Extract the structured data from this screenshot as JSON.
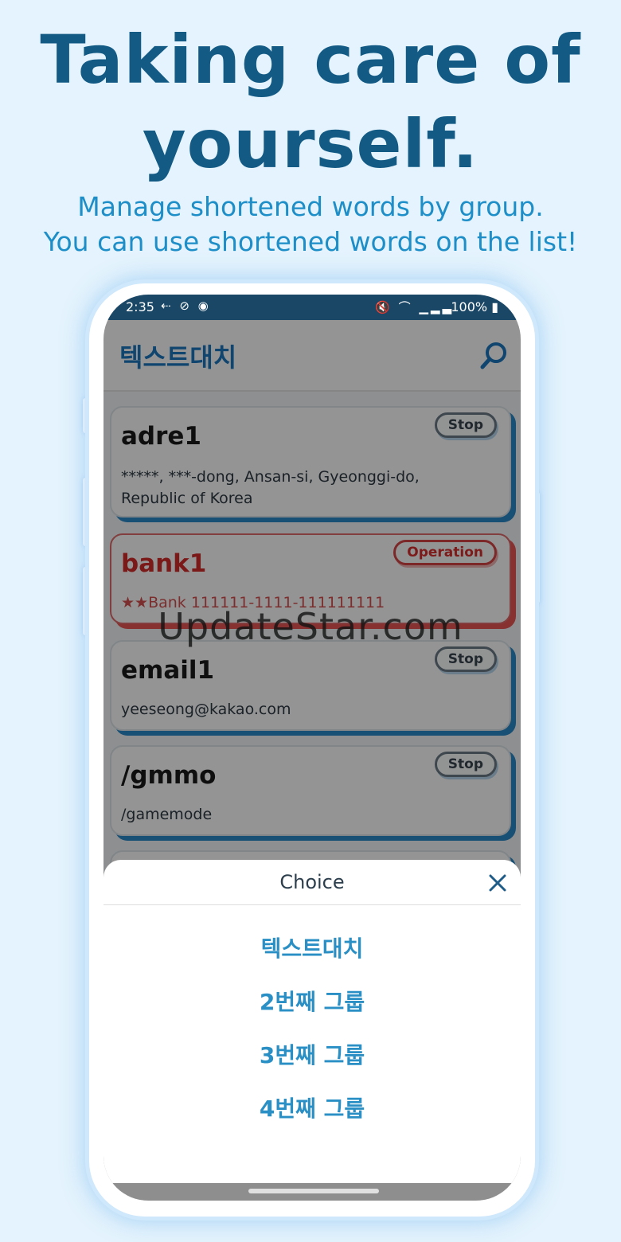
{
  "headline": {
    "line1": "Taking care of",
    "line2": "yourself."
  },
  "subtitle": {
    "line1": "Manage shortened words by group.",
    "line2": "You can use shortened words on the list!"
  },
  "status_bar": {
    "time": "2:35",
    "left_icons": "⇠ ⊘ ◉",
    "right_icons": "🔇 ⌒ ▁▂▃",
    "battery": "100% ▮"
  },
  "app": {
    "title": "텍스트대치",
    "search_icon": "search-icon"
  },
  "cards": [
    {
      "title": "adre1",
      "text": "*****, ***-dong, Ansan-si, Gyeonggi-do, Republic of Korea",
      "status": "Stop",
      "active": false
    },
    {
      "title": "bank1",
      "text": "★★Bank 111111-1111-111111111",
      "status": "Operation",
      "active": true
    },
    {
      "title": "email1",
      "text": "yeeseong@kakao.com",
      "status": "Stop",
      "active": false
    },
    {
      "title": "/gmmo",
      "text": "/gamemode",
      "status": "Stop",
      "active": false
    }
  ],
  "sheet": {
    "title": "Choice",
    "options": [
      "텍스트대치",
      "2번째 그룹",
      "3번째 그룹",
      "4번째 그룹"
    ]
  },
  "watermark": "UpdateStar.com",
  "colors": {
    "background": "#e4f3fd",
    "headline": "#135a85",
    "subtitle": "#1d8ec7",
    "app_title": "#1a77bf",
    "card_shadow": "#2a88c8",
    "active_red": "#d42c2c",
    "option_blue": "#2a8fc4"
  }
}
